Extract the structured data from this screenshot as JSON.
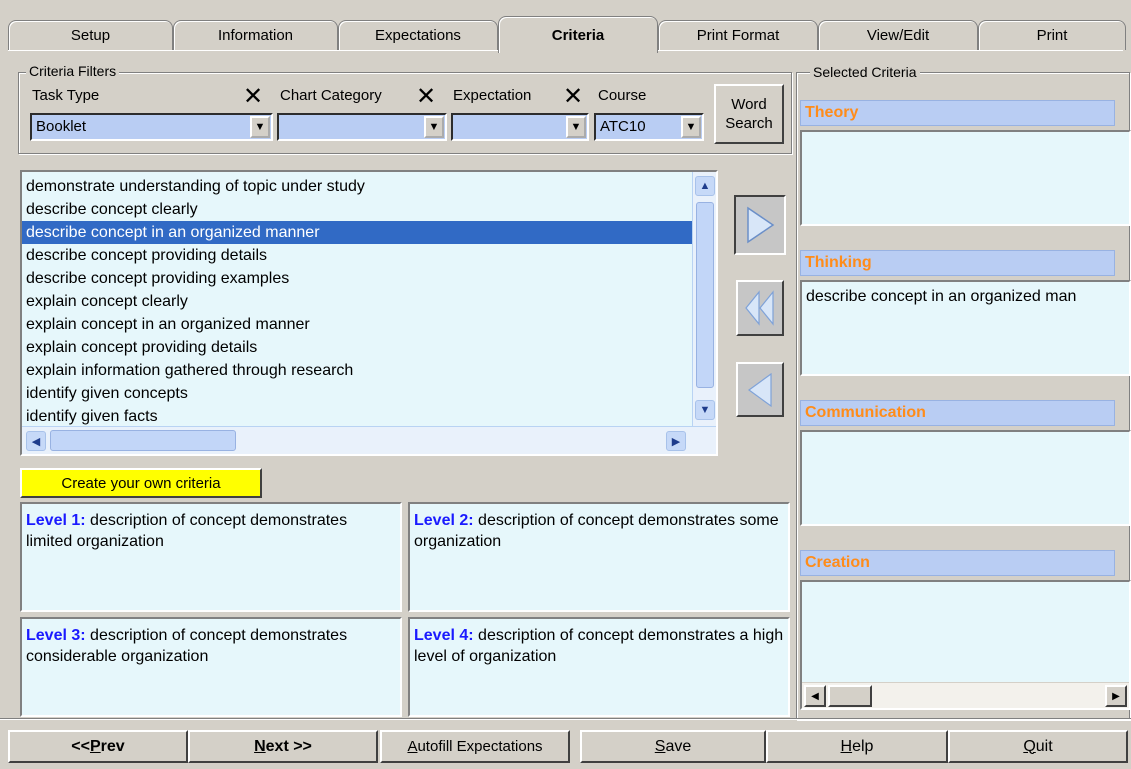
{
  "tabs": [
    {
      "label": "Setup"
    },
    {
      "label": "Information"
    },
    {
      "label": "Expectations"
    },
    {
      "label": "Criteria"
    },
    {
      "label": "Print Format"
    },
    {
      "label": "View/Edit"
    },
    {
      "label": "Print"
    }
  ],
  "filters": {
    "title": "Criteria Filters",
    "task_type_label": "Task Type",
    "task_type_value": "Booklet",
    "chart_category_label": "Chart Category",
    "chart_category_value": "",
    "expectation_label": "Expectation",
    "expectation_value": "",
    "course_label": "Course",
    "course_value": "ATC10",
    "word_search_label": "Word Search",
    "clear_icon": "x-icon"
  },
  "criteria_list": {
    "items": [
      "demonstrate understanding of topic under study",
      "describe concept clearly",
      "describe concept in an organized manner",
      "describe concept providing details",
      "describe concept providing examples",
      "explain concept clearly",
      "explain concept in an organized manner",
      "explain concept providing details",
      "explain information gathered through research",
      "identify given concepts",
      "identify given facts"
    ],
    "selected_index": 2
  },
  "create_own_label": "Create your own criteria",
  "levels": [
    {
      "prefix": "Level 1:",
      "text": " description of concept demonstrates limited organization"
    },
    {
      "prefix": "Level 2:",
      "text": " description of concept demonstrates some organization"
    },
    {
      "prefix": "Level 3:",
      "text": " description of concept demonstrates considerable organization"
    },
    {
      "prefix": "Level 4:",
      "text": " description of concept demonstrates a high level of organization"
    }
  ],
  "selected_criteria": {
    "title": "Selected Criteria",
    "categories": [
      {
        "name": "Theory",
        "items": []
      },
      {
        "name": "Thinking",
        "items": [
          "describe concept in an organized man"
        ]
      },
      {
        "name": "Communication",
        "items": []
      },
      {
        "name": "Creation",
        "items": []
      }
    ]
  },
  "bottom_buttons": {
    "prev": {
      "pre": "<< ",
      "ul": "P",
      "post": "rev"
    },
    "next": {
      "pre": "",
      "ul": "N",
      "post": "ext >>"
    },
    "autofill": {
      "pre": "",
      "ul": "A",
      "post": "utofill Expectations"
    },
    "save": {
      "pre": "",
      "ul": "S",
      "post": "ave"
    },
    "help": {
      "pre": "",
      "ul": "H",
      "post": "elp"
    },
    "quit": {
      "pre": "",
      "ul": "Q",
      "post": "uit"
    }
  },
  "colors": {
    "accent_header": "#ff8c1a",
    "level_prefix": "#1a1aff",
    "selection": "#316ac5",
    "create_button": "#ffff00"
  }
}
